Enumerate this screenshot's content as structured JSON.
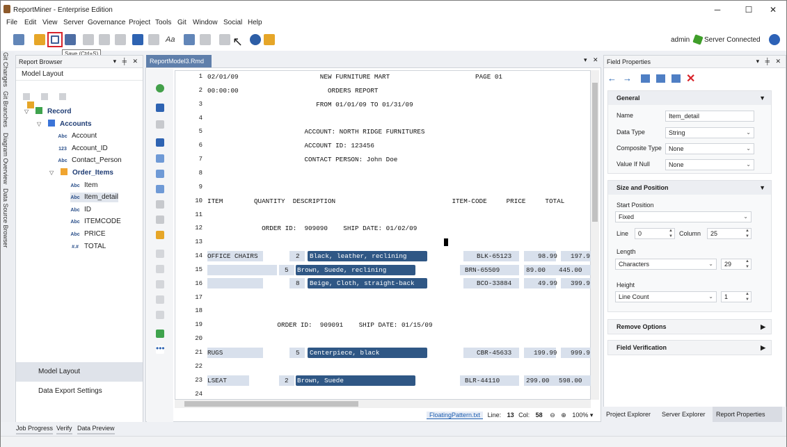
{
  "window": {
    "title": "ReportMiner - Enterprise Edition",
    "controls": {
      "minimize": "─",
      "maximize": "☐",
      "close": "✕"
    }
  },
  "menu": [
    "File",
    "Edit",
    "View",
    "Server",
    "Governance",
    "Project",
    "Tools",
    "Git",
    "Window",
    "Social",
    "Help"
  ],
  "toolbar": {
    "save_tooltip": "Save (Ctrl+S)",
    "user": "admin",
    "server_status": "Server Connected"
  },
  "left_strip": [
    "Git Changes",
    "Git Branches",
    "Diagram Overview",
    "Data Source Browser"
  ],
  "report_browser": {
    "title": "Report Browser",
    "tab": "Model Layout",
    "tree": [
      {
        "label": "Record",
        "badge": "",
        "level": 0
      },
      {
        "label": "Accounts",
        "badge": "",
        "level": 1
      },
      {
        "label": "Account",
        "badge": "Abc",
        "level": 2
      },
      {
        "label": "Account_ID",
        "badge": "123",
        "level": 2
      },
      {
        "label": "Contact_Person",
        "badge": "Abc",
        "level": 2
      },
      {
        "label": "Order_Items",
        "badge": "",
        "level": 2
      },
      {
        "label": "Item",
        "badge": "Abc",
        "level": 3
      },
      {
        "label": "Item_detail",
        "badge": "Abc",
        "level": 3
      },
      {
        "label": "ID",
        "badge": "Abc",
        "level": 3
      },
      {
        "label": "ITEMCODE",
        "badge": "Abc",
        "level": 3
      },
      {
        "label": "PRICE",
        "badge": "Abc",
        "level": 3
      },
      {
        "label": "TOTAL",
        "badge": "#.#",
        "level": 3
      }
    ],
    "bottom_buttons": [
      "Model Layout",
      "Data Export Settings"
    ]
  },
  "editor": {
    "tab": "ReportModel3.Rmd",
    "lines": [
      {
        "no": "1",
        "text": "02/01/09                     NEW FURNITURE MART                      PAGE 01"
      },
      {
        "no": "2",
        "text": "00:00:00                       ORDERS REPORT"
      },
      {
        "no": "3",
        "text": "                            FROM 01/01/09 TO 01/31/09"
      },
      {
        "no": "4",
        "text": ""
      },
      {
        "no": "5",
        "text": "                         ACCOUNT: NORTH RIDGE FURNITURES"
      },
      {
        "no": "6",
        "text": "                         ACCOUNT ID: 123456"
      },
      {
        "no": "7",
        "text": "                         CONTACT PERSON: John Doe"
      },
      {
        "no": "8",
        "text": ""
      },
      {
        "no": "9",
        "text": ""
      },
      {
        "no": "10",
        "text": "ITEM        QUANTITY  DESCRIPTION                              ITEM-CODE     PRICE     TOTAL"
      },
      {
        "no": "11",
        "text": ""
      },
      {
        "no": "12",
        "text": "              ORDER ID:  909090    SHIP DATE: 01/02/09"
      },
      {
        "no": "13",
        "text": ""
      },
      {
        "no": "14",
        "text": ""
      },
      {
        "no": "15",
        "text": ""
      },
      {
        "no": "16",
        "text": ""
      },
      {
        "no": "17",
        "text": ""
      },
      {
        "no": "18",
        "text": ""
      },
      {
        "no": "19",
        "text": "                  ORDER ID:  909091    SHIP DATE: 01/15/09"
      },
      {
        "no": "20",
        "text": ""
      },
      {
        "no": "21",
        "text": ""
      },
      {
        "no": "22",
        "text": ""
      },
      {
        "no": "23",
        "text": ""
      },
      {
        "no": "24",
        "text": ""
      }
    ],
    "highlights": {
      "r14": {
        "item": "OFFICE CHAIRS",
        "qty": "2",
        "desc": "Black, leather, reclining",
        "code": "BLK-65123",
        "price": "98.99",
        "total": "197.9"
      },
      "r15": {
        "qty": "5",
        "desc": "Brown, Suede, reclining",
        "code": "BRN-65509",
        "price": "89.00",
        "total": "445.00"
      },
      "r16": {
        "qty": "8",
        "desc": "Beige, Cloth, straight-back",
        "code": "BCO-33884",
        "price": "49.99",
        "total": "399.9"
      },
      "r21": {
        "item": "RUGS",
        "qty": "5",
        "desc": "Centerpiece, black",
        "code": "CBR-45633",
        "price": "199.99",
        "total": "999.9"
      },
      "r23": {
        "item": "LSEAT",
        "qty": "2",
        "desc": "Brown, Suede",
        "code": "BLR-44110",
        "price": "299.00",
        "total": "598.00"
      }
    },
    "status": {
      "file": "FloatingPattern.txt",
      "line_label": "Line:",
      "line": "13",
      "col_label": "Col:",
      "col": "58",
      "zoom": "100%"
    }
  },
  "field_properties": {
    "title": "Field Properties",
    "general": {
      "title": "General",
      "name_label": "Name",
      "name": "Item_detail",
      "datatype_label": "Data Type",
      "datatype": "String",
      "composite_label": "Composite Type",
      "composite": "None",
      "null_label": "Value If Null",
      "null_value": "None"
    },
    "size": {
      "title": "Size and Position",
      "start_label": "Start Position",
      "start": "Fixed",
      "line_label": "Line",
      "line": "0",
      "column_label": "Column",
      "column": "25",
      "length_label": "Length",
      "length_unit": "Characters",
      "length": "29",
      "height_label": "Height",
      "height_unit": "Line Count",
      "height": "1"
    },
    "remove_options": "Remove Options",
    "field_verification": "Field Verification",
    "tabs": [
      "Project Explorer",
      "Server Explorer",
      "Report Properties"
    ]
  },
  "bottom_tabs": [
    "Job Progress",
    "Verify",
    "Data Preview"
  ]
}
